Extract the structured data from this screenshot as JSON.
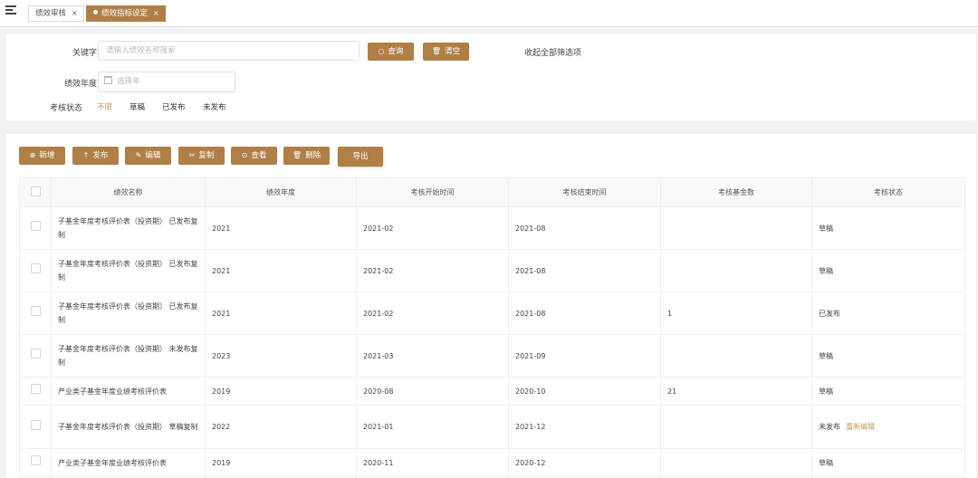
{
  "tabs": [
    {
      "label": "绩效审核",
      "close": "×"
    },
    {
      "label": "绩效指标设定",
      "close": "×"
    }
  ],
  "filter": {
    "keyword_label": "关键字",
    "keyword_placeholder": "请输入绩效名称搜索",
    "search_button": "查询",
    "clear_button": "清空",
    "collapse_link": "收起全部筛选项",
    "year_label": "绩效年度",
    "year_placeholder": "选择年",
    "status_label": "考核状态",
    "status_options": [
      "不限",
      "草稿",
      "已发布",
      "未发布"
    ],
    "status_selected": "不限"
  },
  "toolbar": {
    "new": "新增",
    "publish": "发布",
    "edit": "编辑",
    "copy": "复制",
    "view": "查看",
    "delete": "删除",
    "export": "导出"
  },
  "table": {
    "columns": [
      "绩效名称",
      "绩效年度",
      "考核开始时间",
      "考核结束时间",
      "考核基金数",
      "考核状态"
    ],
    "rows": [
      {
        "name": "子基金年度考核评价表（投资期） 已发布复制",
        "year": "2021",
        "start": "2021-02",
        "end": "2021-08",
        "count": "",
        "status": "草稿",
        "action": ""
      },
      {
        "name": "子基金年度考核评价表（投资期） 已发布复制",
        "year": "2021",
        "start": "2021-02",
        "end": "2021-08",
        "count": "",
        "status": "草稿",
        "action": ""
      },
      {
        "name": "子基金年度考核评价表（投资期） 已发布复制",
        "year": "2021",
        "start": "2021-02",
        "end": "2021-08",
        "count": "1",
        "status": "已发布",
        "action": ""
      },
      {
        "name": "子基金年度考核评价表（投资期） 未发布复制",
        "year": "2023",
        "start": "2021-03",
        "end": "2021-09",
        "count": "",
        "status": "草稿",
        "action": ""
      },
      {
        "name": "产业类子基金年度业绩考核评价表",
        "year": "2019",
        "start": "2020-08",
        "end": "2020-10",
        "count": "21",
        "status": "草稿",
        "action": ""
      },
      {
        "name": "子基金年度考核评价表（投资期） 草稿复制",
        "year": "2022",
        "start": "2021-01",
        "end": "2021-12",
        "count": "",
        "status": "未发布",
        "action": "重新编辑"
      },
      {
        "name": "产业类子基金年度业绩考核评价表",
        "year": "2019",
        "start": "2020-11",
        "end": "2020-12",
        "count": "",
        "status": "草稿",
        "action": ""
      }
    ]
  },
  "colors": {
    "accent": "#b07f46",
    "link": "#c8955a"
  },
  "icons": {
    "menu": "menu-toggle-icon",
    "search": "search-icon",
    "clear": "trash-icon"
  }
}
